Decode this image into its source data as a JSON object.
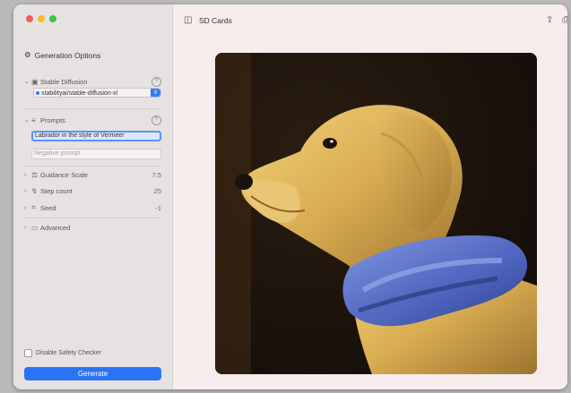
{
  "window": {
    "toolbar_title": "SD Cards"
  },
  "sidebar": {
    "section_title": "Generation Options",
    "model": {
      "label": "Stable Diffusion",
      "selected": "stabilityai/stable-diffusion-xl"
    },
    "prompts": {
      "label": "Prompts",
      "positive": "Labrador in the style of Vermeer",
      "negative_placeholder": "Negative prompt"
    },
    "rows": [
      {
        "label": "Guidance Scale",
        "value": "7.5"
      },
      {
        "label": "Step count",
        "value": "25"
      },
      {
        "label": "Seed",
        "value": "-1"
      },
      {
        "label": "Advanced",
        "value": ""
      }
    ],
    "safety_label": "Disable Safety Checker",
    "generate_label": "Generate"
  },
  "icons": {
    "sidebar_toggle": "sidebar-toggle-icon",
    "share": "share-icon",
    "save": "save-icon"
  }
}
